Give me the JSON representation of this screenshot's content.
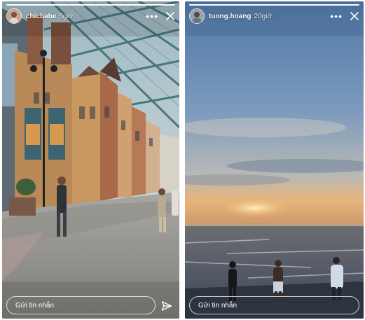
{
  "stories": [
    {
      "username": "chicbabe",
      "time": "5giờ",
      "reply_placeholder": "Gửi tin nhắn",
      "progress": 1.0,
      "icons": {
        "more": "more-horizontal-icon",
        "close": "close-icon",
        "send": "send-icon"
      }
    },
    {
      "username": "tuong.hoang",
      "time": "20giờ",
      "reply_placeholder": "Gửi tin nhắn",
      "progress": 1.0,
      "icons": {
        "more": "more-horizontal-icon",
        "close": "close-icon"
      }
    }
  ],
  "colors": {
    "text": "#ffffff",
    "sky_top": "#5f85b3",
    "sunset": "#e8a55e",
    "sea": "#4d5a6b"
  }
}
